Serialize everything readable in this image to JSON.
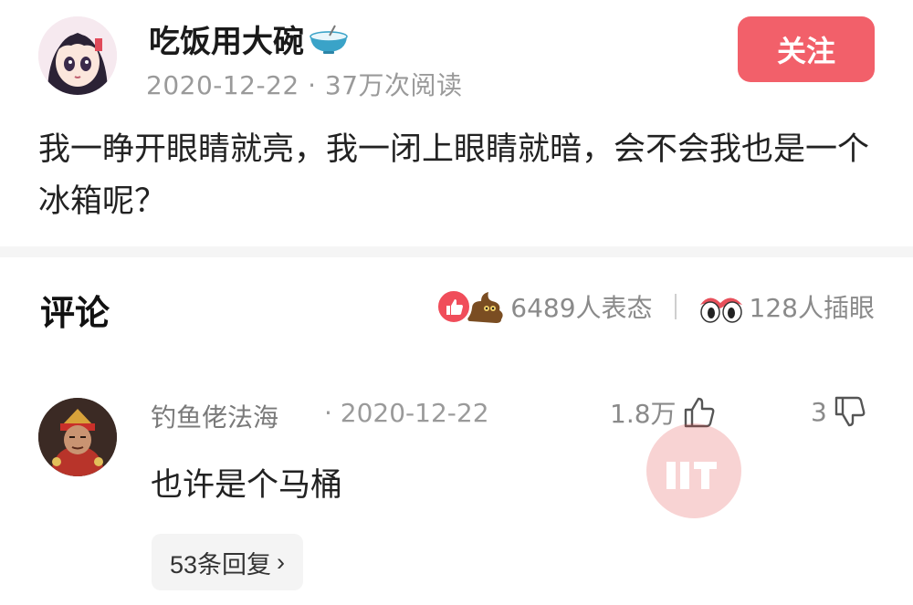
{
  "post": {
    "author": "吃饭用大碗",
    "meta": "2020-12-22 · 37万次阅读",
    "follow_label": "关注",
    "content": "我一睁开眼睛就亮，我一闭上眼睛就暗，会不会我也是一个冰箱呢？"
  },
  "comments_section": {
    "title": "评论",
    "reactions_count": "6489人表态",
    "eyes_count": "128人插眼"
  },
  "comment": {
    "user": "钓鱼佬法海",
    "date": "· 2020-12-22",
    "likes": "1.8万",
    "dislikes": "3",
    "text": "也许是个马桶",
    "replies_label": "53条回复",
    "replies_chevron": "›"
  },
  "icons": {
    "bowl": "bowl-emoji-icon",
    "like_reaction": "thumbs-up-reaction-icon",
    "poop_reaction": "poop-reaction-icon",
    "eyes": "eyes-icon",
    "thumb_up": "thumb-up-icon",
    "thumb_down": "thumb-down-icon"
  },
  "colors": {
    "follow_button": "#f2606a",
    "like_reaction": "#f04d5a",
    "muted_text": "#9a9a9a"
  }
}
